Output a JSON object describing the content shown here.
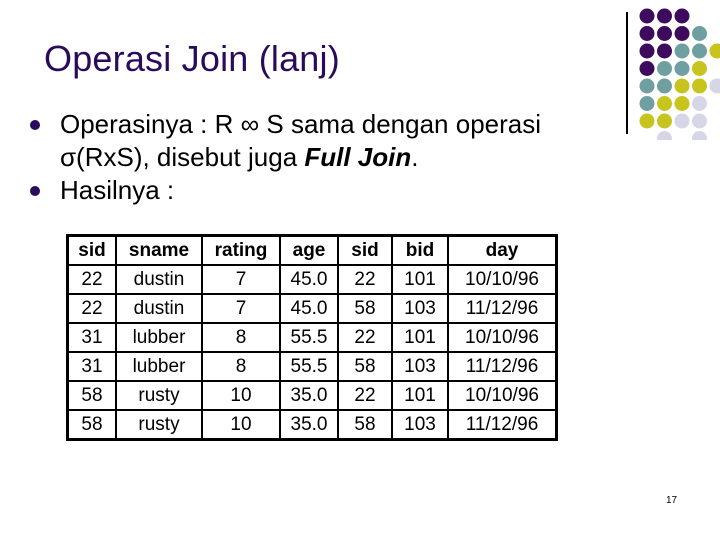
{
  "slide": {
    "title": "Operasi Join (lanj)",
    "bullets": [
      {
        "text_before": "Operasinya : R ∞ S sama dengan operasi σ(RxS), disebut juga ",
        "emphasis": "Full Join",
        "text_after": "."
      },
      {
        "text_before": "Hasilnya :",
        "emphasis": "",
        "text_after": ""
      }
    ],
    "page_number": "17"
  },
  "colors": {
    "title": "#2a0a5a",
    "bullet": "#2a0a5a",
    "dot_purple": "#3d0a5e",
    "dot_teal": "#6f9fa0",
    "dot_yellow": "#c8c41e",
    "dot_lavender": "#d6d6e6"
  },
  "decoration": {
    "dot_grid_rows": [
      [
        "purple",
        "purple",
        "purple"
      ],
      [
        "purple",
        "purple",
        "purple",
        "teal"
      ],
      [
        "purple",
        "purple",
        "teal",
        "teal",
        "yellow"
      ],
      [
        "purple",
        "teal",
        "teal",
        "yellow"
      ],
      [
        "teal",
        "teal",
        "yellow",
        "yellow",
        "lavender"
      ],
      [
        "teal",
        "yellow",
        "yellow",
        "lavender"
      ],
      [
        "yellow",
        "yellow",
        "lavender",
        "lavender"
      ],
      [
        "",
        "lavender",
        "",
        "lavender"
      ]
    ]
  },
  "table": {
    "headers": [
      "sid",
      "sname",
      "rating",
      "age",
      "sid",
      "bid",
      "day"
    ],
    "rows": [
      [
        "22",
        "dustin",
        "7",
        "45.0",
        "22",
        "101",
        "10/10/96"
      ],
      [
        "22",
        "dustin",
        "7",
        "45.0",
        "58",
        "103",
        "11/12/96"
      ],
      [
        "31",
        "lubber",
        "8",
        "55.5",
        "22",
        "101",
        "10/10/96"
      ],
      [
        "31",
        "lubber",
        "8",
        "55.5",
        "58",
        "103",
        "11/12/96"
      ],
      [
        "58",
        "rusty",
        "10",
        "35.0",
        "22",
        "101",
        "10/10/96"
      ],
      [
        "58",
        "rusty",
        "10",
        "35.0",
        "58",
        "103",
        "11/12/96"
      ]
    ]
  }
}
